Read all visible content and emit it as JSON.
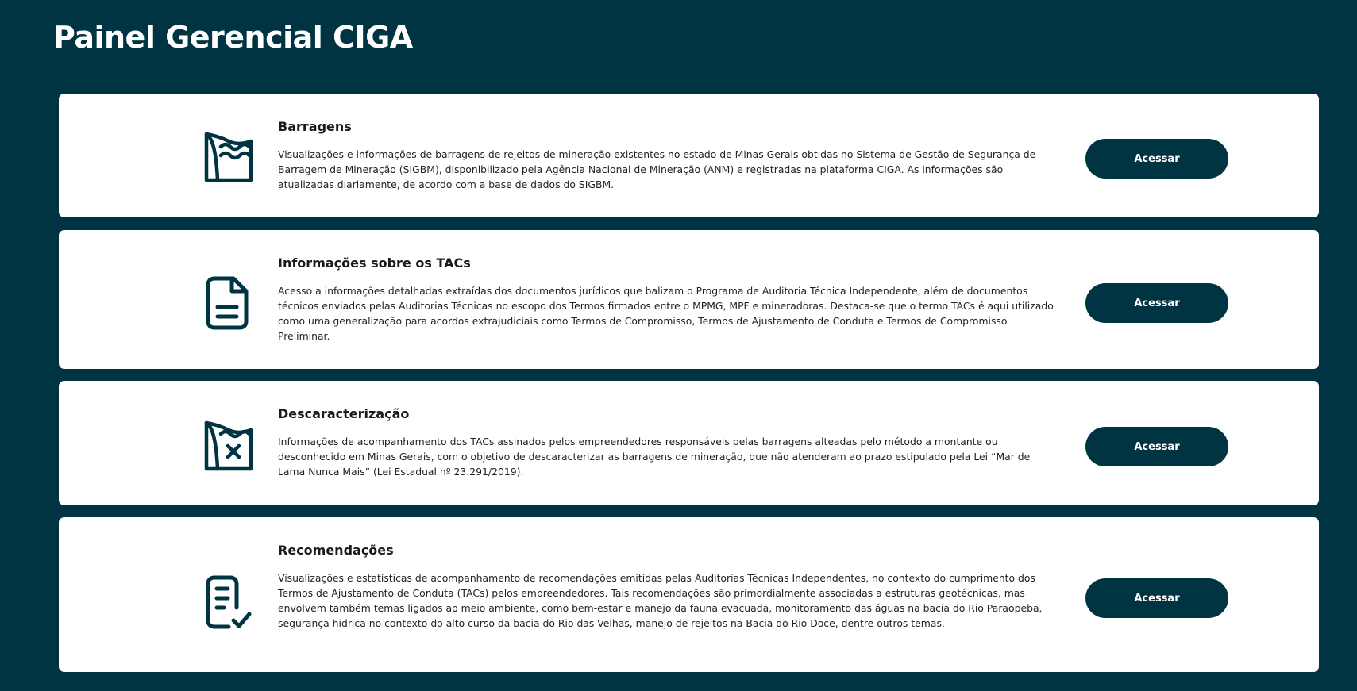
{
  "header": {
    "title": "Painel Gerencial CIGA"
  },
  "colors": {
    "background": "#003443",
    "card": "#ffffff",
    "button": "#003443",
    "icon": "#003443"
  },
  "cards": [
    {
      "icon": "dam-icon",
      "title": "Barragens",
      "description": "Visualizações e informações de barragens de rejeitos de mineração existentes no estado de Minas Gerais obtidas no Sistema de Gestão de Segurança de Barragem de Mineração (SIGBM), disponibilizado pela Agência Nacional de Mineração (ANM) e registradas na plataforma CIGA. As informações são atualizadas diariamente, de acordo com a base de dados do SIGBM.",
      "button_label": "Acessar"
    },
    {
      "icon": "document-icon",
      "title": "Informações sobre os TACs",
      "description": "Acesso a informações detalhadas extraídas dos documentos jurídicos que balizam o Programa de Auditoria Técnica Independente, além de documentos técnicos enviados pelas Auditorias Técnicas no escopo dos Termos firmados entre o MPMG, MPF e mineradoras. Destaca-se que o termo TACs é aqui utilizado como uma generalização para acordos extrajudiciais como Termos de Compromisso, Termos de Ajustamento de Conduta e Termos de Compromisso Preliminar.",
      "button_label": "Acessar"
    },
    {
      "icon": "dam-decharacterization-icon",
      "title": "Descaracterização",
      "description": "Informações de acompanhamento dos TACs assinados pelos empreendedores responsáveis pelas barragens alteadas pelo método a montante ou desconhecido em Minas Gerais, com o objetivo de descaracterizar as barragens de mineração, que não atenderam ao prazo estipulado pela Lei “Mar de Lama Nunca Mais” (Lei Estadual nº 23.291/2019).",
      "button_label": "Acessar"
    },
    {
      "icon": "checklist-icon",
      "title": "Recomendações",
      "description": "Visualizações e estatísticas de acompanhamento de recomendações emitidas pelas Auditorias Técnicas Independentes, no contexto do cumprimento dos Termos de Ajustamento de Conduta (TACs) pelos empreendedores. Tais recomendações são primordialmente associadas a estruturas geotécnicas, mas envolvem também temas ligados ao meio ambiente, como bem-estar e manejo da fauna evacuada, monitoramento das águas na bacia do Rio Paraopeba, segurança hídrica no contexto do alto curso da bacia do Rio das Velhas, manejo de rejeitos na Bacia do Rio Doce, dentre outros temas.",
      "button_label": "Acessar"
    }
  ]
}
